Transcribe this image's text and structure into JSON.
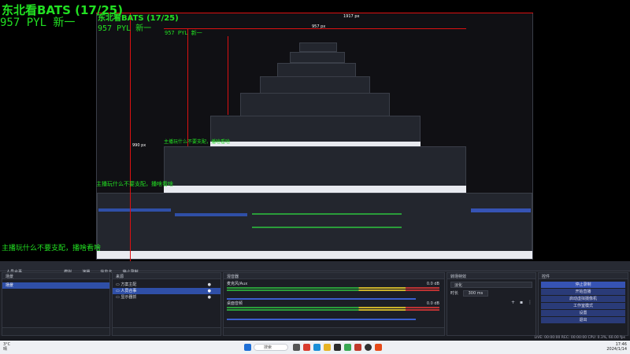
{
  "overlay": {
    "title": "东北看BATS (17/25)",
    "code": "957 PYL 新一",
    "caption": "主播玩什么不要支配，播啥看啥",
    "width_label_1": "1917 px",
    "width_label_2": "957 px",
    "height_label_1": "990 px"
  },
  "toolbar": {
    "items": [
      "人员合事",
      "模拟",
      "演播",
      "信息卡",
      "停止录制",
      "关闭",
      "设置"
    ]
  },
  "scenes": {
    "header": "场景",
    "items": [
      "场景"
    ]
  },
  "sources": {
    "header": "来源",
    "items": [
      "方案主配",
      "人员合事",
      "显示器抓"
    ]
  },
  "mixer": {
    "header": "混音器",
    "tracks": [
      {
        "name": "桌面音频",
        "level": "0.0 dB"
      },
      {
        "name": "麦克风/Aux",
        "level": "0.0 dB"
      }
    ]
  },
  "transitions": {
    "header": "转场特效",
    "type": "淡化",
    "duration_label": "时长",
    "duration_value": "300 ms"
  },
  "controls": {
    "header": "控件",
    "buttons": [
      "停止录制",
      "开始直播",
      "启动虚拟摄像机",
      "工作室模式",
      "设置",
      "退出"
    ]
  },
  "status": {
    "text": "LIVE: 00:00:00   REC: 00:00:00   CPU: 0.3%, 60.00 fps"
  },
  "taskbar": {
    "weather_temp": "3°C",
    "weather_desc": "晴",
    "search": "搜索",
    "time": "17:46",
    "date": "2024/1/14"
  },
  "colors": {
    "overlay_green": "#22e022",
    "accent_blue": "#3653b4",
    "guide_red": "#dd1111"
  }
}
